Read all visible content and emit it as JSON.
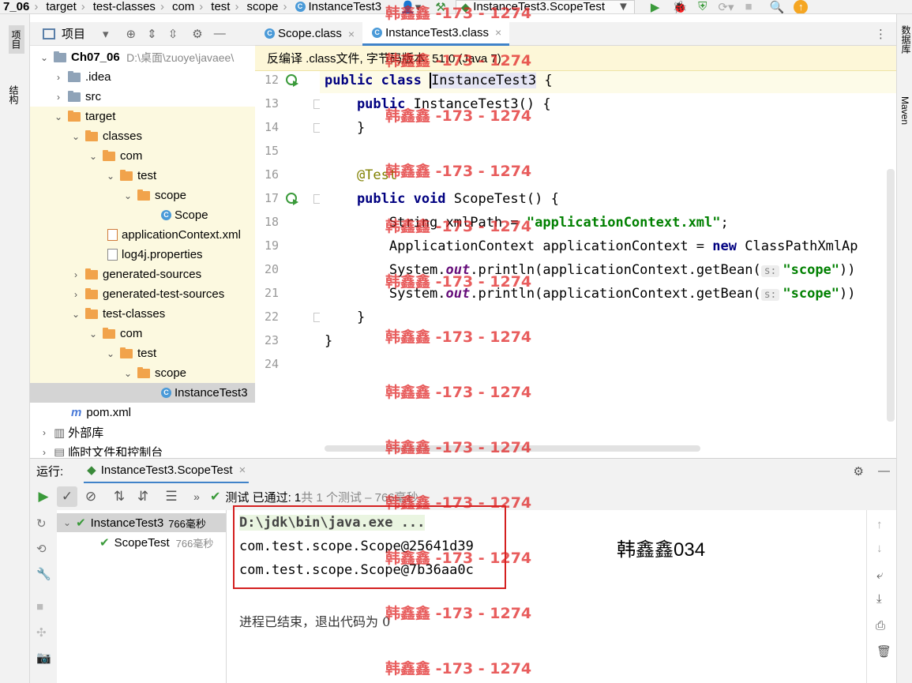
{
  "navbar": {
    "crumbs": [
      "7_06",
      "target",
      "test-classes",
      "com",
      "test",
      "scope",
      "InstanceTest3"
    ],
    "run_config": "InstanceTest3.ScopeTest"
  },
  "left_strip": {
    "tab1": "项目",
    "tab2": "结构"
  },
  "right_strip": {
    "tab1": "数据库",
    "tab2": "Maven"
  },
  "project": {
    "header": "项目",
    "root_name": "Ch07_06",
    "root_path": "D:\\桌面\\zuoye\\javaee\\",
    "nodes": {
      "idea": ".idea",
      "src": "src",
      "target": "target",
      "classes": "classes",
      "com1": "com",
      "test1": "test",
      "scope1": "scope",
      "scope_class": "Scope",
      "appctx": "applicationContext.xml",
      "log4j": "log4j.properties",
      "gen_src": "generated-sources",
      "gen_test_src": "generated-test-sources",
      "test_classes": "test-classes",
      "com2": "com",
      "test2": "test",
      "scope2": "scope",
      "instance": "InstanceTest3",
      "pom": "pom.xml",
      "ext_libs": "外部库",
      "scratches": "临时文件和控制台"
    }
  },
  "editor": {
    "tabs": [
      "Scope.class",
      "InstanceTest3.class"
    ],
    "banner": "反编译 .class文件, 字节码版本: 51.0 (Java 7)",
    "line_numbers": [
      "12",
      "13",
      "14",
      "15",
      "16",
      "17",
      "18",
      "19",
      "20",
      "21",
      "22",
      "23",
      "24"
    ],
    "code": {
      "l12_kw": "public class ",
      "l12_name": "InstanceTest3",
      "l12_rest": " {",
      "l13_kw": "    public ",
      "l13_rest": "InstanceTest3() {",
      "l14": "    }",
      "l16": "    @Test",
      "l17_kw": "    public void ",
      "l17_rest": "ScopeTest() {",
      "l18_a": "        String xmlPath = ",
      "l18_str": "\"applicationContext.xml\"",
      "l18_b": ";",
      "l19_a": "        ApplicationContext applicationContext = ",
      "l19_kw": "new ",
      "l19_b": "ClassPathXmlAp",
      "l20_a": "        System.",
      "l20_fld": "out",
      "l20_b": ".println(applicationContext.getBean(",
      "hint": "s:",
      "l20_str": "\"scope\"",
      "l20_c": "))",
      "l22": "    }",
      "l23": "}"
    }
  },
  "run": {
    "label": "运行:",
    "tab": "InstanceTest3.ScopeTest",
    "status_pass": "测试 已通过: 1",
    "status_rest": "共 1 个测试 – 766毫秒",
    "test_root": "InstanceTest3",
    "test_root_time": "766毫秒",
    "test_child": "ScopeTest",
    "test_child_time": "766毫秒",
    "console": {
      "line1": "D:\\jdk\\bin\\java.exe ...",
      "line2": "com.test.scope.Scope@25641d39",
      "line3": "com.test.scope.Scope@7b36aa0c",
      "exit": "进程已结束，退出代码为 0",
      "note": "韩鑫鑫034"
    }
  },
  "watermark": "韩鑫鑫 -173 - 1274",
  "colors": {
    "accent": "#4083c9",
    "pass": "#59a869",
    "warn_box": "#d42020"
  }
}
